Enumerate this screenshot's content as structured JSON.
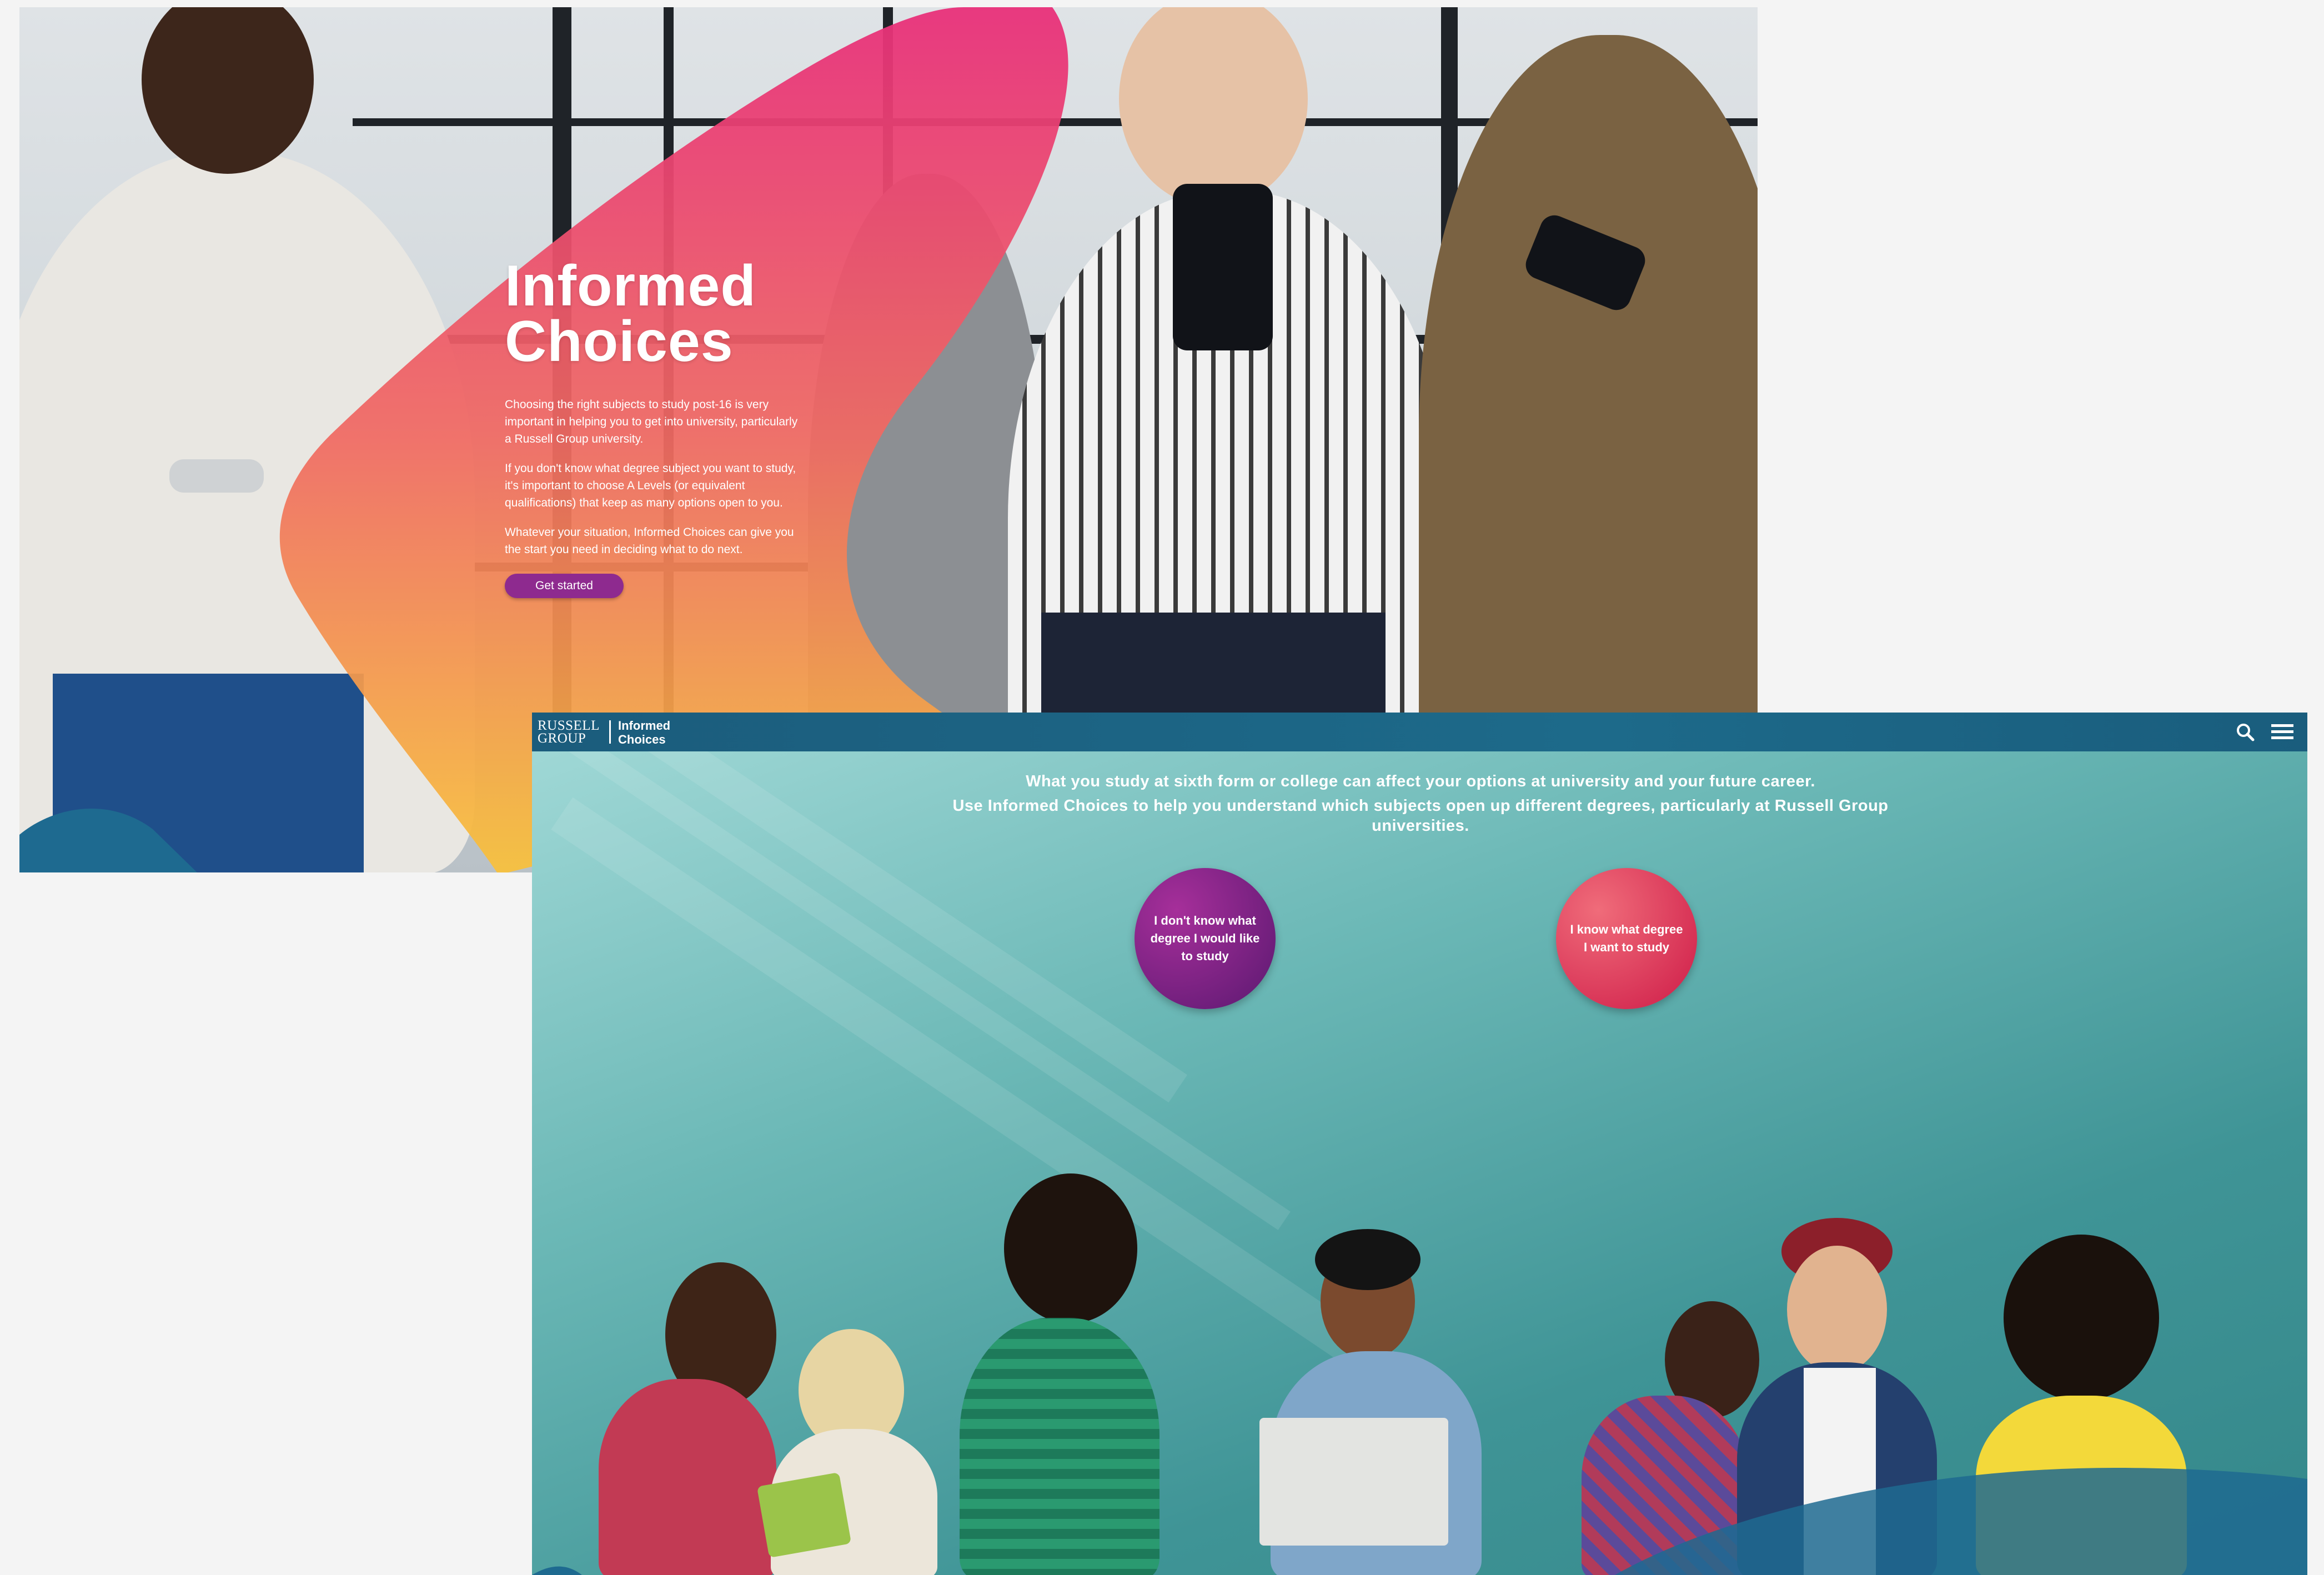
{
  "hero": {
    "title_line1": "Informed",
    "title_line2": "Choices",
    "paragraphs": [
      "Choosing the right subjects to study post-16 is very important in helping you to get into university, particularly a Russell Group university.",
      "If you don't know what degree subject you want to study, it's important to choose A Levels (or equivalent qualifications) that keep as many options open to you.",
      "Whatever your situation, Informed Choices can give you the start you need in deciding what to do next."
    ],
    "button_label": "Get started",
    "colors": {
      "blob_top": "#e8307a",
      "blob_bottom": "#f7b23b",
      "button": "#8e2a8f"
    }
  },
  "nav": {
    "logo_line1": "RUSSELL",
    "logo_line2": "GROUP",
    "product_line1": "Informed",
    "product_line2": "Choices",
    "icons": [
      "search-icon",
      "menu-icon"
    ],
    "bar_color": "#1b5c7c"
  },
  "landing": {
    "intro_line1": "What you study at sixth form or college can affect your options at university and your future career.",
    "intro_line2": "Use Informed Choices to help you understand which subjects open up different degrees, particularly at Russell Group universities.",
    "option_dont_know": "I don't know what degree I would like to study",
    "option_know": "I know what degree I want to study",
    "colors": {
      "dont_know": "#7d2285",
      "know": "#e53b5c",
      "background": "#4a9fa0"
    }
  }
}
